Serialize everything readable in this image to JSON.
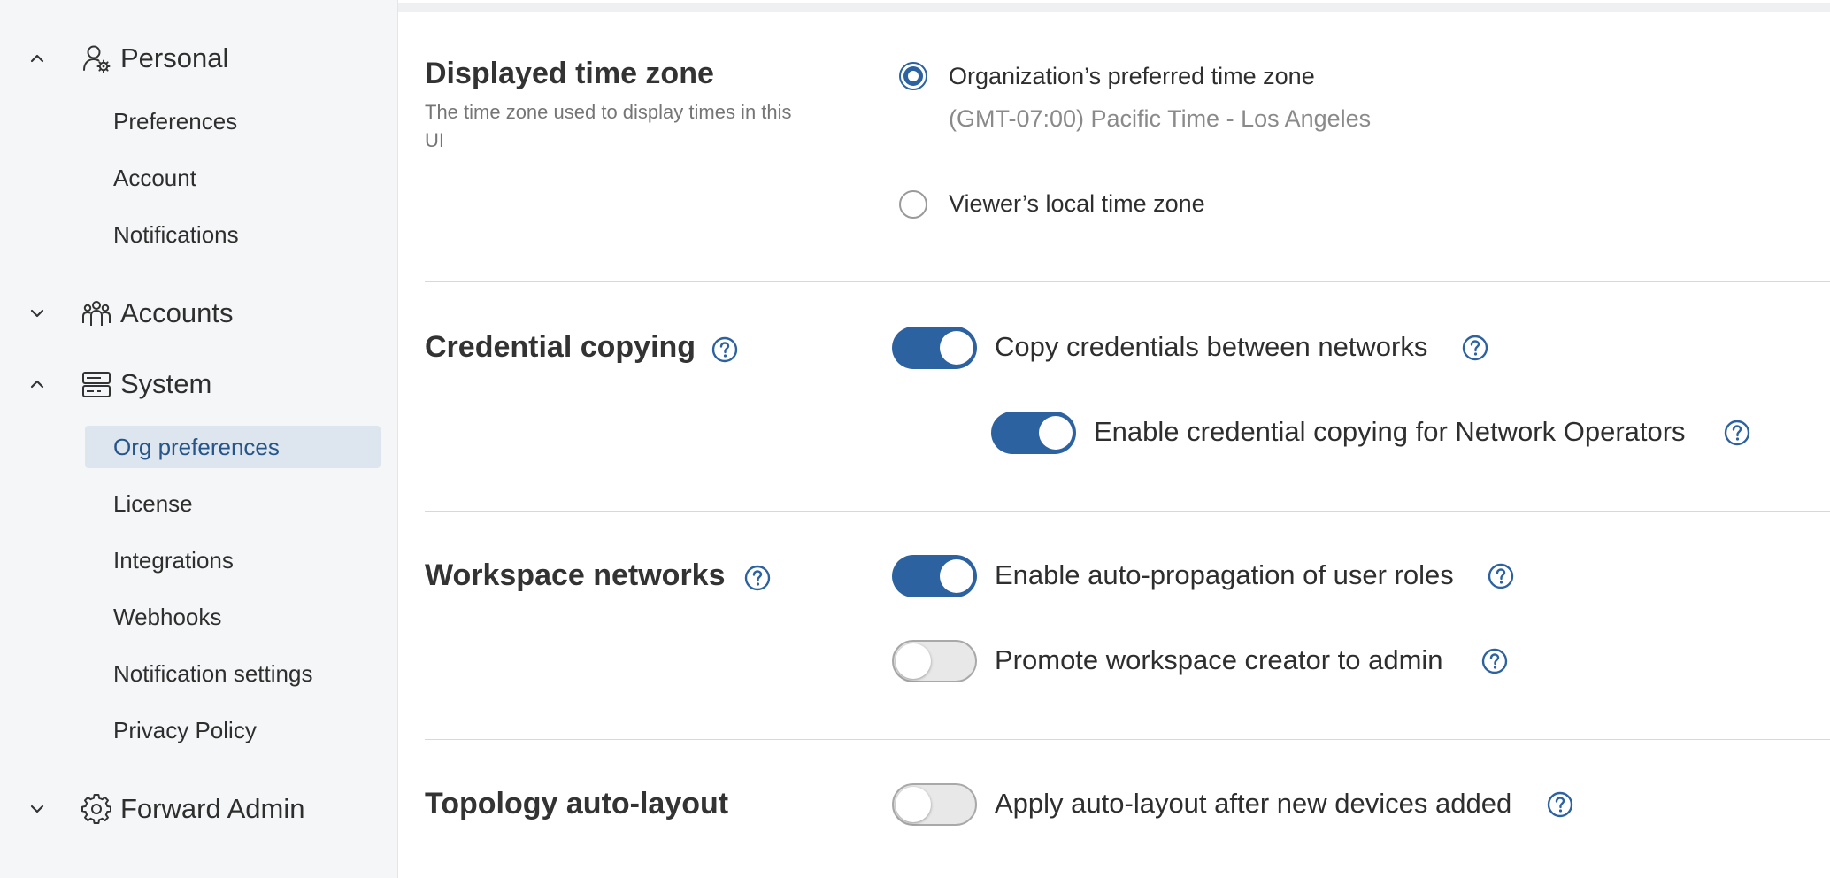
{
  "colors": {
    "accent": "#2d62a0",
    "active_bg": "#dde5ee",
    "active_text": "#26558a"
  },
  "sidebar": {
    "groups": [
      {
        "label": "Personal",
        "icon": "user-gear-icon",
        "expanded": true
      },
      {
        "label": "Accounts",
        "icon": "users-group-icon",
        "expanded": false
      },
      {
        "label": "System",
        "icon": "server-icon",
        "expanded": true
      },
      {
        "label": "Forward Admin",
        "icon": "gear-icon",
        "expanded": false
      }
    ],
    "personal_items": [
      "Preferences",
      "Account",
      "Notifications"
    ],
    "system_items": [
      "Org preferences",
      "License",
      "Integrations",
      "Webhooks",
      "Notification settings",
      "Privacy Policy"
    ],
    "active_item": "Org preferences"
  },
  "sections": {
    "time_zone": {
      "title": "Displayed time zone",
      "subtitle": "The time zone used to display times in this UI",
      "options": [
        {
          "label": "Organization’s preferred time zone",
          "detail": "(GMT-07:00) Pacific Time - Los Angeles",
          "selected": true
        },
        {
          "label": "Viewer’s local time zone",
          "selected": false
        }
      ]
    },
    "credential_copying": {
      "title": "Credential copying",
      "toggles": [
        {
          "label": "Copy credentials between networks",
          "on": true
        },
        {
          "label": "Enable credential copying for Network Operators",
          "on": true
        }
      ]
    },
    "workspace_networks": {
      "title": "Workspace networks",
      "toggles": [
        {
          "label": "Enable auto-propagation of user roles",
          "on": true
        },
        {
          "label": "Promote workspace creator to admin",
          "on": false
        }
      ]
    },
    "topology": {
      "title": "Topology auto-layout",
      "toggles": [
        {
          "label": "Apply auto-layout after new devices added",
          "on": false
        }
      ]
    }
  }
}
